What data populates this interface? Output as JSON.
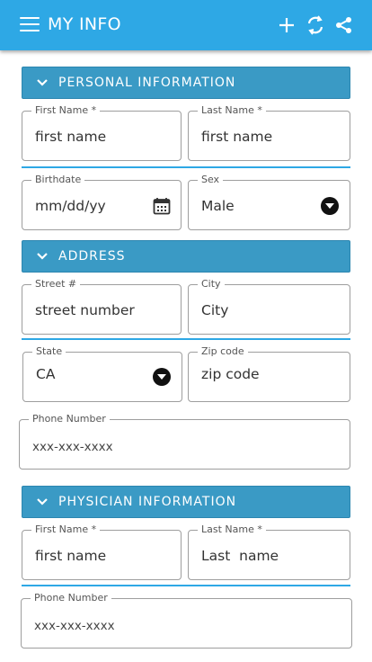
{
  "appbar": {
    "title": "MY INFO",
    "icons": [
      "menu-icon",
      "add-icon",
      "sync-icon",
      "share-icon"
    ]
  },
  "sections": {
    "personal": {
      "title": "PERSONAL INFORMATION",
      "first_name": {
        "label": "First Name *",
        "value": "first name"
      },
      "last_name": {
        "label": "Last Name *",
        "value": "first name"
      },
      "birthdate": {
        "label": "Birthdate",
        "value": "mm/dd/yy"
      },
      "sex": {
        "label": "Sex",
        "value": "Male"
      }
    },
    "address": {
      "title": "ADDRESS",
      "street": {
        "label": "Street #",
        "value": "street number"
      },
      "city": {
        "label": "City",
        "value": "City"
      },
      "state": {
        "label": "State",
        "value": "CA"
      },
      "zip": {
        "label": "Zip code",
        "value": "zip code"
      },
      "phone": {
        "label": "Phone Number",
        "value": "xxx-xxx-xxxx"
      }
    },
    "physician": {
      "title": "PHYSICIAN INFORMATION",
      "first_name": {
        "label": "First Name *",
        "value": "first name"
      },
      "last_name": {
        "label": "Last Name *",
        "value": "Last  name"
      },
      "phone": {
        "label": "Phone Number",
        "value": "xxx-xxx-xxxx"
      }
    }
  },
  "colors": {
    "appbar": "#2ea8e5",
    "section_header": "#3a9ac5",
    "divider": "#2ea8e5"
  }
}
